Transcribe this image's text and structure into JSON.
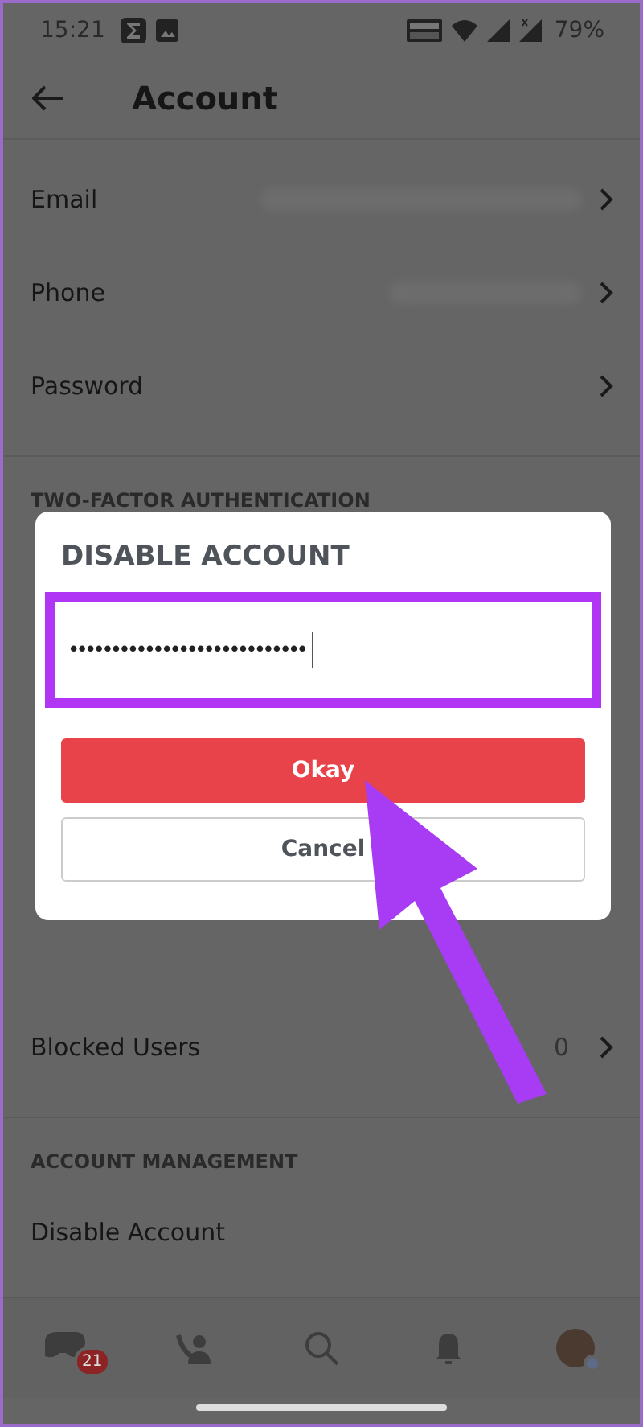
{
  "status_bar": {
    "time": "15:21",
    "battery": "79%"
  },
  "header": {
    "title": "Account"
  },
  "groups": [
    {
      "rows": [
        {
          "label": "Email",
          "blurred_value": true,
          "chevron": true
        },
        {
          "label": "Phone",
          "blurred_value": true,
          "chevron": true
        },
        {
          "label": "Password",
          "blurred_value": false,
          "chevron": true
        }
      ]
    },
    {
      "heading": "TWO-FACTOR AUTHENTICATION",
      "rows": [
        {
          "label": "Blocked Users",
          "count": "0",
          "blurred_value": false,
          "chevron": true
        }
      ]
    },
    {
      "heading": "ACCOUNT MANAGEMENT",
      "rows": [
        {
          "label": "Disable Account",
          "blurred_value": false,
          "chevron": false
        }
      ]
    }
  ],
  "dialog": {
    "title": "DISABLE ACCOUNT",
    "field": {
      "value": "••••••••••••••••••••••••••••",
      "highlighted": true
    },
    "buttons": [
      {
        "label": "Okay",
        "kind": "primary"
      },
      {
        "label": "Cancel",
        "kind": "secondary"
      }
    ]
  },
  "nav": [
    {
      "kind": "home",
      "badge": "21"
    },
    {
      "kind": "friends"
    },
    {
      "kind": "search"
    },
    {
      "kind": "bell"
    },
    {
      "kind": "avatar"
    }
  ]
}
